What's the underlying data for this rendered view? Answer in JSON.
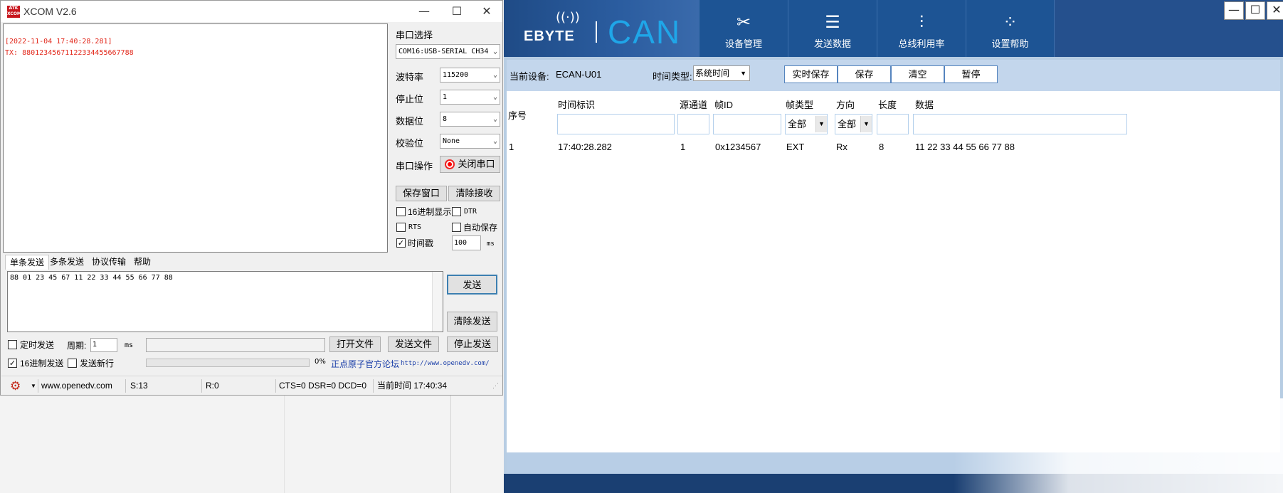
{
  "xcom": {
    "title": "XCOM V2.6",
    "logo_text": "ATK XCOM",
    "window_buttons": [
      "—",
      "☐",
      "✕"
    ],
    "receive_lines": [
      "[2022-11-04 17:40:28.281]",
      "TX: 8801234567112233445566778​8"
    ],
    "port_section_label": "串口选择",
    "port_value": "COM16:USB-SERIAL CH34",
    "baud_label": "波特率",
    "baud_value": "115200",
    "stopbit_label": "停止位",
    "stopbit_value": "1",
    "databit_label": "数据位",
    "databit_value": "8",
    "parity_label": "校验位",
    "parity_value": "None",
    "port_op_label": "串口操作",
    "close_port_label": "关闭串口",
    "save_window_label": "保存窗口",
    "clear_receive_label": "清除接收",
    "hex_display_label": "16进制显示",
    "dtr_label": "DTR",
    "rts_label": "RTS",
    "autosave_label": "自动保存",
    "timestamp_label": "时间戳",
    "timestamp_value": "100",
    "timestamp_unit": "ms",
    "tabs": [
      "单条发送",
      "多条发送",
      "协议传输",
      "帮助"
    ],
    "send_text": "88 01 23 45 67 11 22 33 44 55 66 77 88",
    "send_label": "发送",
    "clear_send_label": "清除发送",
    "timed_send_label": "定时发送",
    "period_label": "周期:",
    "period_value": "1",
    "period_unit": "ms",
    "open_file_label": "打开文件",
    "send_file_label": "发送文件",
    "stop_send_label": "停止发送",
    "hex_send_label": "16进制发送",
    "send_newline_label": "发送新行",
    "progress_value": "0%",
    "forum_label": "正点原子官方论坛",
    "forum_url": "http://www.openedv.com/",
    "status": {
      "url": "www.openedv.com",
      "sent": "S:13",
      "received": "R:0",
      "lines": "CTS=0 DSR=0 DCD=0",
      "time": "当前时间 17:40:34"
    }
  },
  "ecan": {
    "brand": "EBYTE",
    "product": "CAN",
    "nav": [
      "设备管理",
      "发送数据",
      "总线利用率",
      "设置帮助"
    ],
    "window_buttons": [
      "—",
      "☐",
      "✕"
    ],
    "device_label": "当前设备:",
    "device_value": "ECAN-U01",
    "time_type_label": "时间类型:",
    "time_type_value": "系统时间",
    "buttons": [
      "实时保存",
      "保存",
      "清空",
      "暂停"
    ],
    "columns": [
      "序号",
      "时间标识",
      "源通道",
      "帧ID",
      "帧类型",
      "方向",
      "长度",
      "数据"
    ],
    "frame_type_filter": "全部",
    "direction_filter": "全部",
    "rows": [
      {
        "index": "1",
        "time": "17:40:28.282",
        "channel": "1",
        "id": "0x1234567",
        "type": "EXT",
        "dir": "Rx",
        "len": "8",
        "data": "11 22 33 44 55 66 77 88"
      }
    ]
  },
  "colors": {
    "ecan_header": "#25508d",
    "ecan_band": "#c3d6ec",
    "rx_text": "#e2281b",
    "can_text": "#1fa6e8"
  }
}
